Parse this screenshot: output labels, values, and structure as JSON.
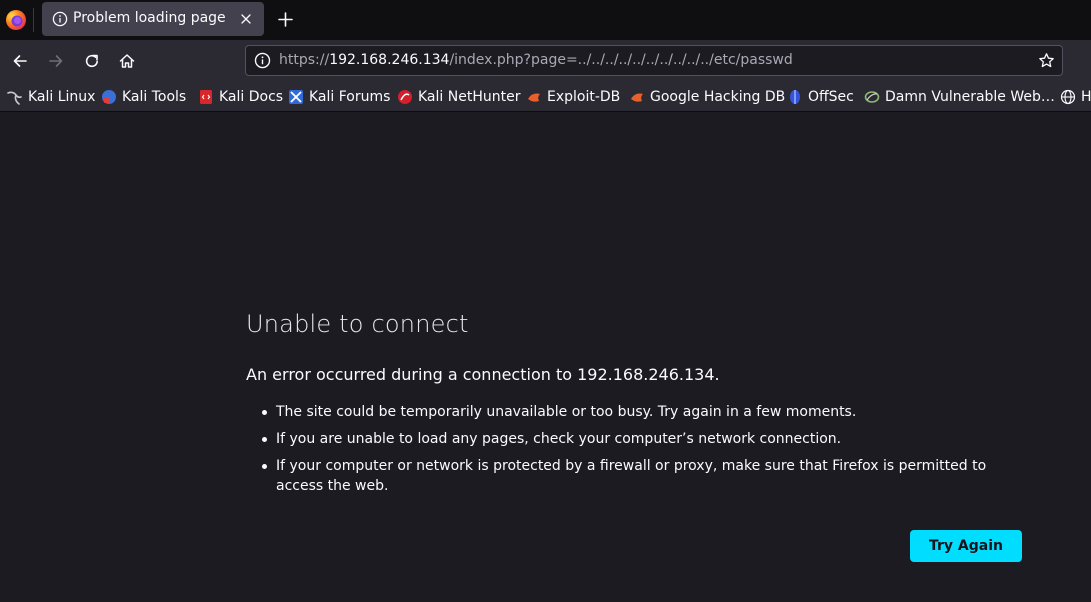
{
  "tab": {
    "title": "Problem loading page",
    "icon": "info-icon",
    "close_icon": "close-icon"
  },
  "toolbar": {
    "back_icon": "back-arrow-icon",
    "forward_icon": "forward-arrow-icon",
    "reload_icon": "reload-icon",
    "home_icon": "home-icon",
    "new_tab_icon": "plus-icon"
  },
  "urlbar": {
    "scheme": "https://",
    "host": "192.168.246.134",
    "path": "/index.php?page=../../../../../../../../../../etc/passwd",
    "bookmark_icon": "star-icon"
  },
  "bookmarks": [
    {
      "label": "Kali Linux",
      "icon": "kali-dragon-icon"
    },
    {
      "label": "Kali Tools",
      "icon": "kali-tools-icon"
    },
    {
      "label": "Kali Docs",
      "icon": "kali-docs-icon"
    },
    {
      "label": "Kali Forums",
      "icon": "kali-forums-icon"
    },
    {
      "label": "Kali NetHunter",
      "icon": "nethunter-icon"
    },
    {
      "label": "Exploit-DB",
      "icon": "exploit-db-icon"
    },
    {
      "label": "Google Hacking DB",
      "icon": "ghdb-icon"
    },
    {
      "label": "OffSec",
      "icon": "offsec-icon"
    },
    {
      "label": "Damn Vulnerable Web…",
      "icon": "dvwa-icon"
    },
    {
      "label": "Ha",
      "icon": "globe-icon"
    }
  ],
  "error": {
    "title": "Unable to connect",
    "description": "An error occurred during a connection to 192.168.246.134.",
    "items": [
      "The site could be temporarily unavailable or too busy. Try again in a few moments.",
      "If you are unable to load any pages, check your computer’s network connection.",
      "If your computer or network is protected by a firewall or proxy, make sure that Firefox is permitted to access the web."
    ],
    "button_label": "Try Again"
  },
  "colors": {
    "accent": "#00ddff",
    "background": "#1c1b22",
    "toolbar": "#2b2a33",
    "tabstrip": "#0f0f12"
  }
}
